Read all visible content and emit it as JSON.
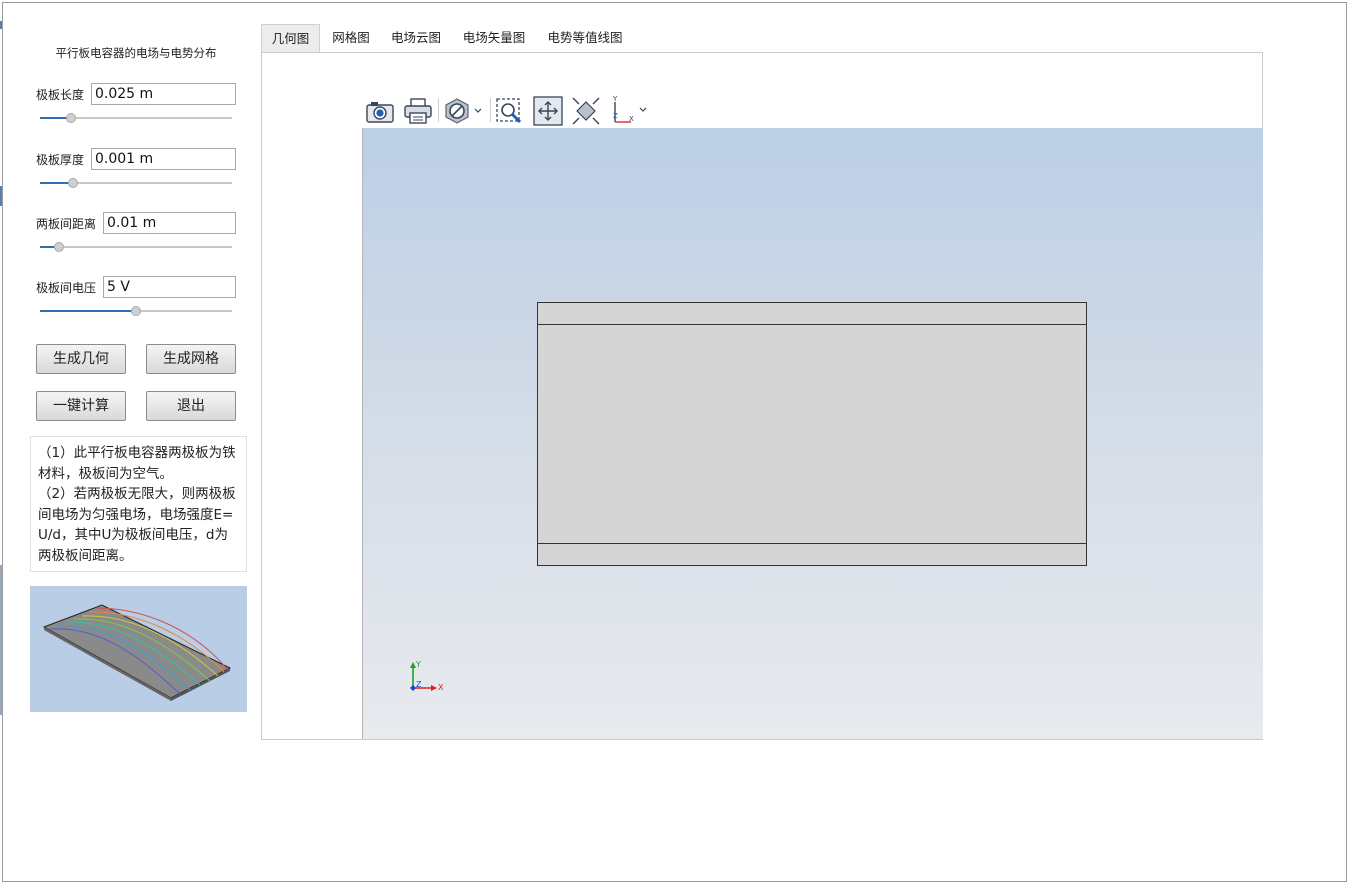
{
  "panel": {
    "title": "平行板电容器的电场与电势分布",
    "params": [
      {
        "label": "极板长度",
        "value": "0.025 m",
        "slider": 0.16
      },
      {
        "label": "极板厚度",
        "value": "0.001 m",
        "slider": 0.17
      },
      {
        "label": "两板间距离",
        "value": "0.01 m",
        "slider": 0.1
      },
      {
        "label": "极板间电压",
        "value": "5 V",
        "slider": 0.5
      }
    ],
    "buttons": {
      "geometry": "生成几何",
      "mesh": "生成网格",
      "compute": "一键计算",
      "exit": "退出"
    },
    "note": "（1）此平行板电容器两极板为铁材料，极板间为空气。\n（2）若两极板无限大，则两极板间电场为匀强电场，电场强度E=U/d，其中U为极板间电压，d为两极板间距离。"
  },
  "tabs": [
    "几何图",
    "网格图",
    "电场云图",
    "电场矢量图",
    "电势等值线图"
  ],
  "active_tab": 0,
  "toolbar": [
    "camera-icon",
    "print-icon",
    "visibility-icon",
    "zoom-box-icon",
    "pan-icon",
    "zoom-extents-icon",
    "axis-orientation-icon"
  ],
  "axis": {
    "x": "X",
    "y": "Y",
    "z": "Z"
  },
  "colors": {
    "accent": "#2c6fb4",
    "viewport_top": "#bccfe5",
    "viewport_bottom": "#e8eaee",
    "geometry_fill": "#d5d5d5"
  }
}
